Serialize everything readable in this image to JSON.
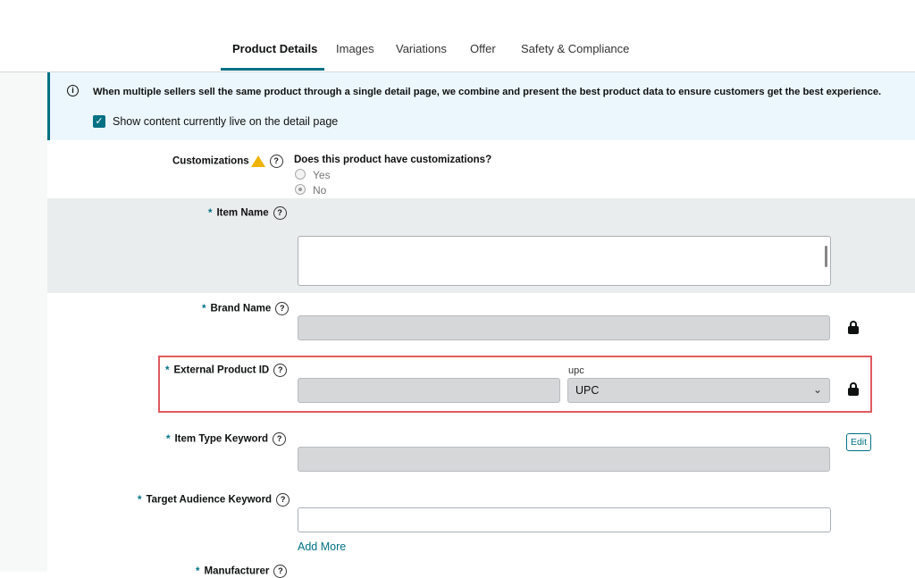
{
  "tabs": [
    {
      "label": "Product Details",
      "active": true
    },
    {
      "label": "Images"
    },
    {
      "label": "Variations"
    },
    {
      "label": "Offer"
    },
    {
      "label": "Safety & Compliance"
    }
  ],
  "banner": {
    "text": "When multiple sellers sell the same product through a single detail page, we combine and present the best product data to ensure customers get the best experience.",
    "checkbox_label": "Show content currently live on the detail page",
    "checked": true
  },
  "customizations": {
    "label": "Customizations",
    "question": "Does this product have customizations?",
    "options": [
      "Yes",
      "No"
    ],
    "selected": "No"
  },
  "fields": {
    "item_name": "Item Name",
    "brand_name": "Brand Name",
    "external_product_id": "External Product ID",
    "id_type_label": "upc",
    "id_type_value": "UPC",
    "item_type_keyword": "Item Type Keyword",
    "edit_label": "Edit",
    "target_audience_keyword": "Target Audience Keyword",
    "add_more": "Add More",
    "manufacturer": "Manufacturer"
  },
  "colors": {
    "accent": "#007185",
    "highlight": "#e05a5f",
    "warning": "#f0b400"
  }
}
